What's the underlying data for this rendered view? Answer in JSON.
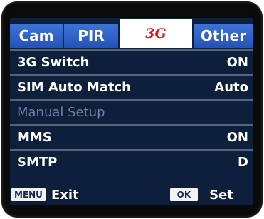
{
  "tabs": [
    {
      "label": "Cam",
      "active": false
    },
    {
      "label": "PIR",
      "active": false
    },
    {
      "label": "3G",
      "active": true
    },
    {
      "label": "Other",
      "active": false
    }
  ],
  "rows": [
    {
      "label": "3G Switch",
      "value": "ON",
      "enabled": true
    },
    {
      "label": "SIM Auto Match",
      "value": "Auto",
      "enabled": true
    },
    {
      "label": "Manual Setup",
      "value": "",
      "enabled": false
    },
    {
      "label": "MMS",
      "value": "ON",
      "enabled": true
    },
    {
      "label": "SMTP",
      "value": "D",
      "enabled": true
    }
  ],
  "footer": {
    "menu_key": "MENU",
    "menu_action": "Exit",
    "ok_key": "OK",
    "ok_action": "Set"
  },
  "colors": {
    "screen_bg": "#0d1f3a",
    "tab_bg": "#2f62cc",
    "active_tab_text": "#e11a1a",
    "disabled_text": "#6e7fa8"
  }
}
